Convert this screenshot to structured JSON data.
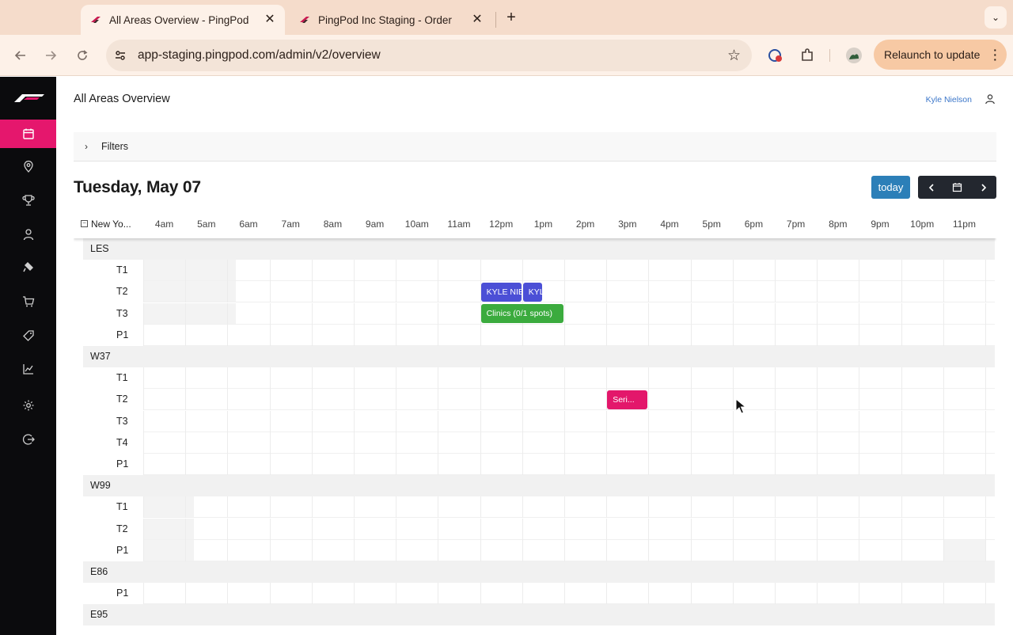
{
  "browser": {
    "tabs": [
      {
        "title": "All Areas Overview - PingPod",
        "active": true
      },
      {
        "title": "PingPod Inc Staging - Order",
        "active": false
      }
    ],
    "url": "app-staging.pingpod.com/admin/v2/overview",
    "relaunch_label": "Relaunch to update"
  },
  "sidebar": {
    "items": [
      {
        "icon": "calendar-icon",
        "active": true
      },
      {
        "icon": "location-pin-icon",
        "active": false
      },
      {
        "icon": "trophy-icon",
        "active": false
      },
      {
        "icon": "user-icon",
        "active": false
      },
      {
        "icon": "paddle-icon",
        "active": false
      },
      {
        "icon": "cart-icon",
        "active": false
      },
      {
        "icon": "tag-icon",
        "active": false
      },
      {
        "icon": "chart-icon",
        "active": false
      },
      {
        "icon": "gear-icon",
        "active": false
      },
      {
        "icon": "logout-icon",
        "active": false
      }
    ]
  },
  "header": {
    "title": "All Areas Overview",
    "user_name": "Kyle Nielson"
  },
  "filters": {
    "label": "Filters"
  },
  "calendar": {
    "date_heading": "Tuesday, May 07",
    "today_label": "today",
    "timezone_label": "New Yo...",
    "hours": [
      "4am",
      "5am",
      "6am",
      "7am",
      "8am",
      "9am",
      "10am",
      "11am",
      "12pm",
      "1pm",
      "2pm",
      "3pm",
      "4pm",
      "5pm",
      "6pm",
      "7pm",
      "8pm",
      "9pm",
      "10pm",
      "11pm"
    ],
    "rows": [
      {
        "type": "group",
        "label": "LES"
      },
      {
        "type": "court",
        "label": "T1"
      },
      {
        "type": "court",
        "label": "T2"
      },
      {
        "type": "court",
        "label": "T3"
      },
      {
        "type": "court",
        "label": "P1"
      },
      {
        "type": "group",
        "label": "W37"
      },
      {
        "type": "court",
        "label": "T1"
      },
      {
        "type": "court",
        "label": "T2"
      },
      {
        "type": "court",
        "label": "T3"
      },
      {
        "type": "court",
        "label": "T4"
      },
      {
        "type": "court",
        "label": "P1"
      },
      {
        "type": "group",
        "label": "W99"
      },
      {
        "type": "court",
        "label": "T1"
      },
      {
        "type": "court",
        "label": "T2"
      },
      {
        "type": "court",
        "label": "P1"
      },
      {
        "type": "group",
        "label": "E86"
      },
      {
        "type": "court",
        "label": "P1"
      },
      {
        "type": "group",
        "label": "E95"
      }
    ],
    "events": [
      {
        "label": "KYLE NIE",
        "color": "#4b4fd6",
        "area": "LES",
        "court": "T2",
        "start": "12pm",
        "end": "1pm"
      },
      {
        "label": "KYL",
        "color": "#4b4fd6",
        "area": "LES",
        "court": "T2",
        "start": "1pm",
        "end": "1:30pm"
      },
      {
        "label": "Clinics (0/1 spots)",
        "color": "#3bab3e",
        "area": "LES",
        "court": "T3",
        "start": "12pm",
        "end": "2pm"
      },
      {
        "label": "Seri...",
        "color": "#e3176b",
        "area": "W37",
        "court": "T2",
        "start": "3pm",
        "end": "4pm"
      }
    ]
  }
}
